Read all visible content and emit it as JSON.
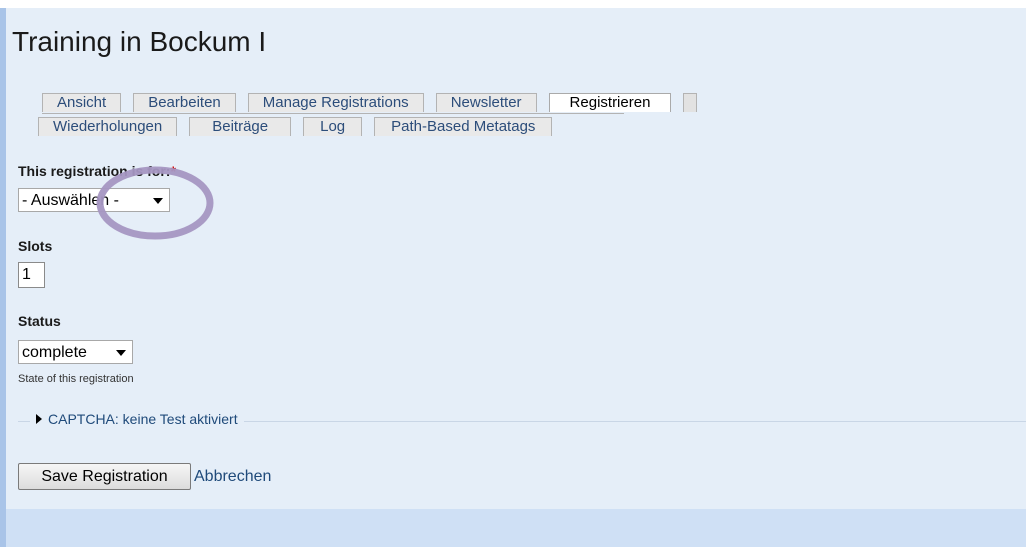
{
  "page": {
    "title": "Training in Bockum I"
  },
  "tabs": {
    "row1": [
      "Ansicht",
      "Bearbeiten",
      "Manage Registrations",
      "Newsletter",
      "Registrieren"
    ],
    "row2": [
      "Wiederholungen",
      "Beiträge",
      "Log",
      "Path-Based Metatags"
    ],
    "active": "Registrieren"
  },
  "form": {
    "registration_for": {
      "label": "This registration is for:",
      "required_mark": "*",
      "value": "- Auswählen -"
    },
    "slots": {
      "label": "Slots",
      "value": "1"
    },
    "status": {
      "label": "Status",
      "value": "complete",
      "description": "State of this registration"
    },
    "captcha": {
      "legend": "CAPTCHA: keine Test aktiviert"
    },
    "save_label": "Save Registration",
    "cancel_label": "Abbrechen"
  },
  "colors": {
    "accent": "#1f4a7a",
    "annotation": "#a596c2",
    "background": "#e5eef8"
  }
}
